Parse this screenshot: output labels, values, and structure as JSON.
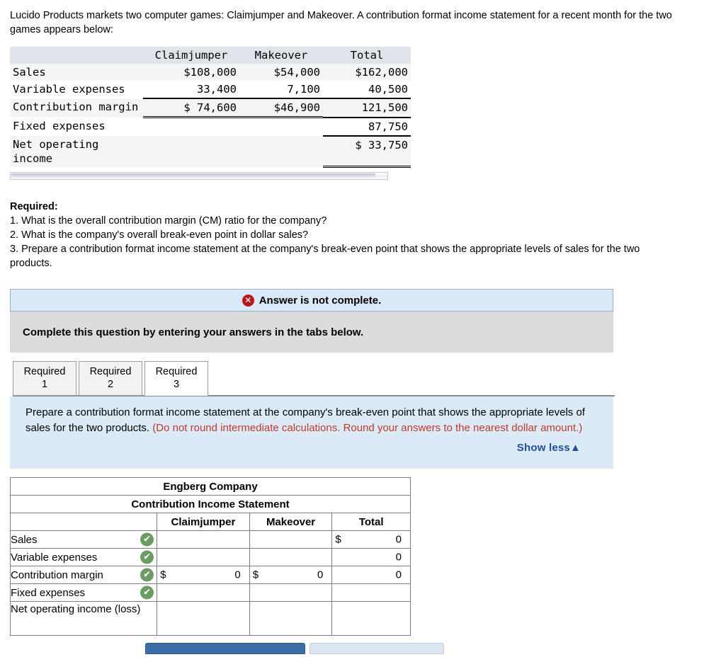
{
  "intro": "Lucido Products markets two computer games: Claimjumper and Makeover. A contribution format income statement for a recent month for the two games appears below:",
  "given_table": {
    "columns": [
      "",
      "Claimjumper",
      "Makeover",
      "Total"
    ],
    "rows": [
      {
        "label": "Sales",
        "claimjumper": "$108,000",
        "makeover": "$54,000",
        "total": "$162,000"
      },
      {
        "label": "Variable expenses",
        "claimjumper": "33,400",
        "makeover": "7,100",
        "total": "40,500"
      },
      {
        "label": "Contribution margin",
        "claimjumper": "$ 74,600",
        "makeover": "$46,900",
        "total": "121,500"
      },
      {
        "label": "Fixed expenses",
        "claimjumper": "",
        "makeover": "",
        "total": "87,750"
      },
      {
        "label": "Net operating income",
        "claimjumper": "",
        "makeover": "",
        "total": "$ 33,750"
      }
    ]
  },
  "required": {
    "heading": "Required:",
    "items": [
      "1. What is the overall contribution margin (CM) ratio for the company?",
      "2. What is the company's overall break-even point in dollar sales?",
      "3. Prepare a contribution format income statement at the company's break-even point that shows the appropriate levels of sales for the two products."
    ]
  },
  "alert": {
    "icon": "error-x-icon",
    "text": "Answer is not complete."
  },
  "gray_bar": {
    "text": "Complete this question by entering your answers in the tabs below."
  },
  "tabs": [
    {
      "line1": "Required",
      "line2": "1",
      "active": false
    },
    {
      "line1": "Required",
      "line2": "2",
      "active": false
    },
    {
      "line1": "Required",
      "line2": "3",
      "active": true
    }
  ],
  "instruction": {
    "black_text": "Prepare a contribution format income statement at the company's break-even point that shows the appropriate levels of sales for the two products. ",
    "red_text": "(Do not round intermediate calculations. Round your answers to the nearest dollar amount.)",
    "show_less": "Show less▲"
  },
  "answer_table": {
    "title1": "Engberg Company",
    "title2": "Contribution Income Statement",
    "columns": [
      "",
      "Claimjumper",
      "Makeover",
      "Total"
    ],
    "rows": [
      {
        "label": "Sales",
        "check": "✔",
        "cj_dollar": "",
        "cj_value": "",
        "mk_dollar": "",
        "mk_value": "",
        "tot_dollar": "$",
        "tot_value": "0"
      },
      {
        "label": "Variable expenses",
        "check": "✔",
        "cj_dollar": "",
        "cj_value": "",
        "mk_dollar": "",
        "mk_value": "",
        "tot_dollar": "",
        "tot_value": "0"
      },
      {
        "label": "Contribution margin",
        "check": "✔",
        "cj_dollar": "$",
        "cj_value": "0",
        "mk_dollar": "$",
        "mk_value": "0",
        "tot_dollar": "",
        "tot_value": "0"
      },
      {
        "label": "Fixed expenses",
        "check": "✔",
        "cj_dollar": "",
        "cj_value": "",
        "mk_dollar": "",
        "mk_value": "",
        "tot_dollar": "",
        "tot_value": ""
      },
      {
        "label": "Net operating income (loss)",
        "check": "",
        "cj_dollar": "",
        "cj_value": "",
        "mk_dollar": "",
        "mk_value": "",
        "tot_dollar": "",
        "tot_value": ""
      }
    ]
  },
  "colors": {
    "header_blue": "#8db3e2",
    "alert_blue": "#dbe8f7",
    "instruction_blue": "#dce9f7",
    "red_text": "#c0392b",
    "link_navy": "#1f4e9c",
    "check_green": "#6d9b63",
    "error_red": "#b21a1a",
    "gray_bar": "#dcdcdc"
  }
}
